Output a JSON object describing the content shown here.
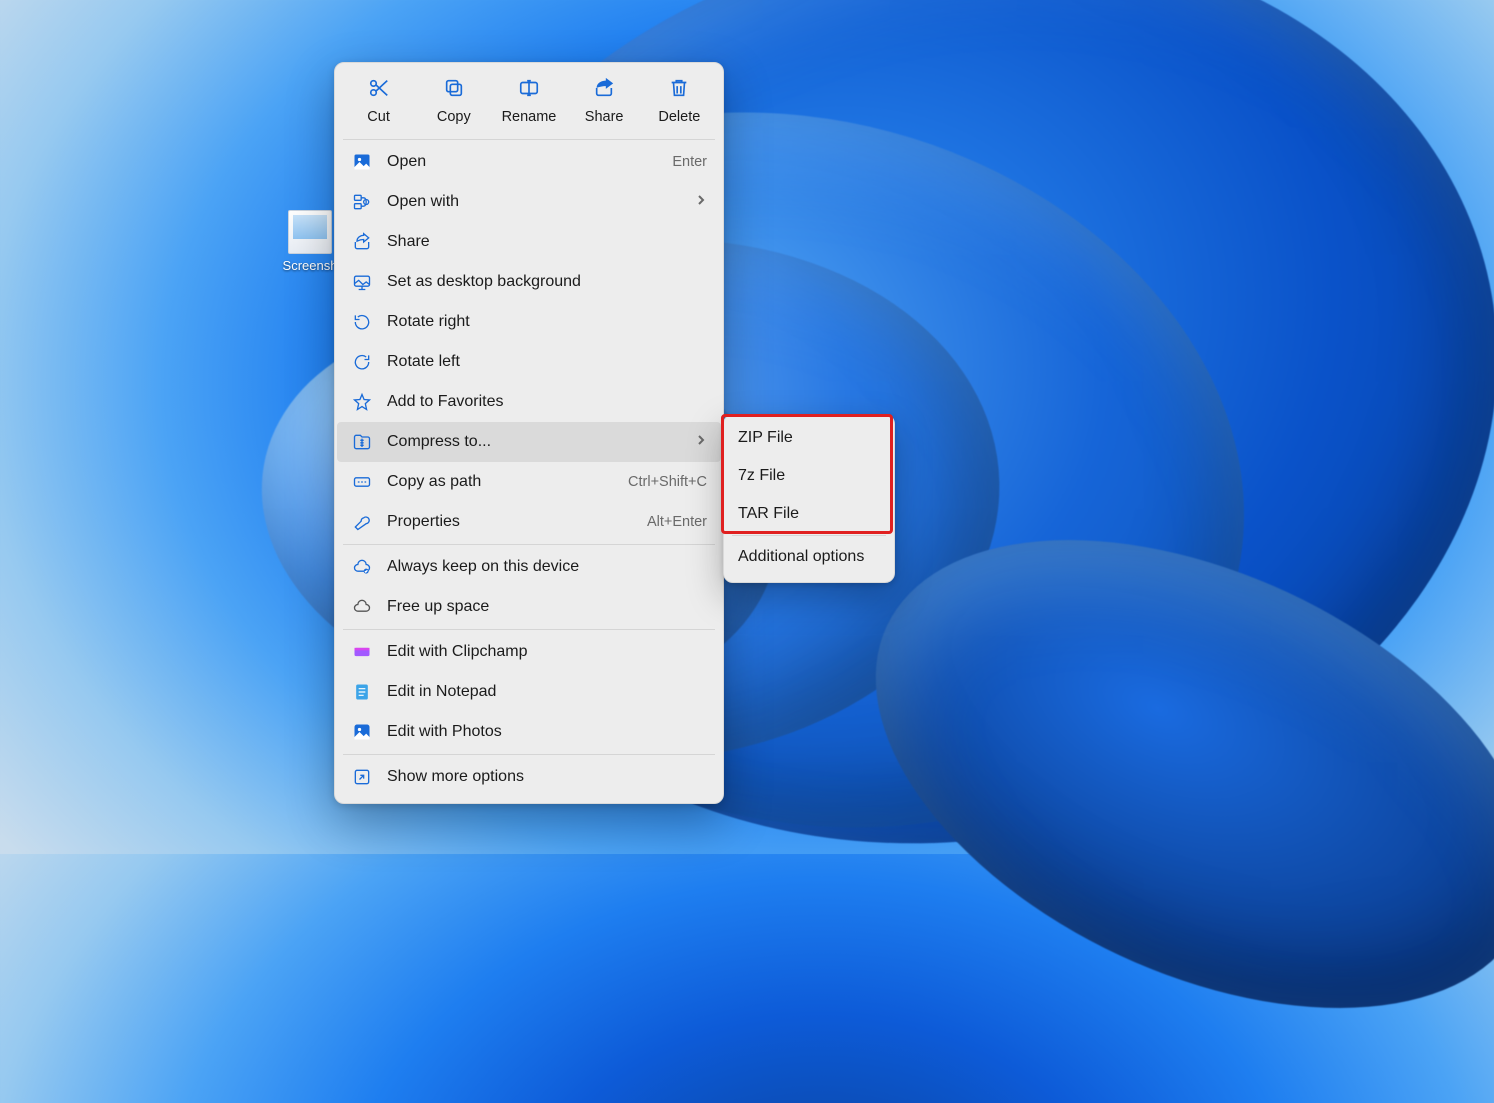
{
  "desktop": {
    "icon_label": "Screensh"
  },
  "toolbar": {
    "cut": "Cut",
    "copy": "Copy",
    "rename": "Rename",
    "share": "Share",
    "delete": "Delete"
  },
  "menu": {
    "open": {
      "label": "Open",
      "hint": "Enter"
    },
    "open_with": {
      "label": "Open with"
    },
    "share": {
      "label": "Share"
    },
    "set_bg": {
      "label": "Set as desktop background"
    },
    "rotate_right": {
      "label": "Rotate right"
    },
    "rotate_left": {
      "label": "Rotate left"
    },
    "favorites": {
      "label": "Add to Favorites"
    },
    "compress": {
      "label": "Compress to..."
    },
    "copy_path": {
      "label": "Copy as path",
      "hint": "Ctrl+Shift+C"
    },
    "properties": {
      "label": "Properties",
      "hint": "Alt+Enter"
    },
    "always_keep": {
      "label": "Always keep on this device"
    },
    "free_space": {
      "label": "Free up space"
    },
    "clipchamp": {
      "label": "Edit with Clipchamp"
    },
    "notepad": {
      "label": "Edit in Notepad"
    },
    "photos": {
      "label": "Edit with Photos"
    },
    "more": {
      "label": "Show more options"
    }
  },
  "submenu": {
    "zip": "ZIP File",
    "sevenz": "7z File",
    "tar": "TAR File",
    "additional": "Additional options"
  }
}
